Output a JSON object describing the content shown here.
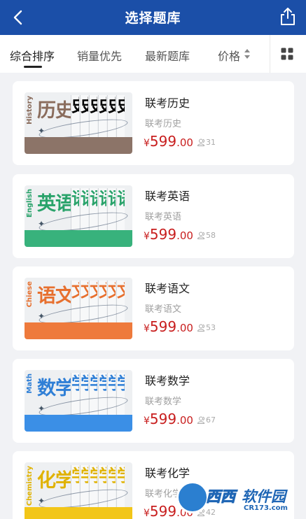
{
  "header": {
    "title": "选择题库"
  },
  "tabs": [
    {
      "label": "综合排序"
    },
    {
      "label": "销量优先"
    },
    {
      "label": "最新题库"
    },
    {
      "label": "价格"
    }
  ],
  "colors": {
    "header": "#1b4fa8",
    "price": "#c81e1e"
  },
  "items": [
    {
      "name": "联考历史",
      "subtitle": "联考历史",
      "currency": "¥",
      "price_int": "599",
      "price_dec": ".00",
      "buyers": "31",
      "cover": {
        "big": "历史",
        "vertical": "History",
        "book_char": "史",
        "band_color": "#8c7468",
        "text_color": "#8a6c5c"
      }
    },
    {
      "name": "联考英语",
      "subtitle": "联考英语",
      "currency": "¥",
      "price_int": "599",
      "price_dec": ".00",
      "buyers": "58",
      "cover": {
        "big": "英语",
        "vertical": "English",
        "book_char": "语",
        "band_color": "#38b27c",
        "text_color": "#2aa36b"
      }
    },
    {
      "name": "联考语文",
      "subtitle": "联考语文",
      "currency": "¥",
      "price_int": "599",
      "price_dec": ".00",
      "buyers": "53",
      "cover": {
        "big": "语文",
        "vertical": "Chiese",
        "book_char": "文",
        "band_color": "#ee7a3c",
        "text_color": "#e7702f"
      }
    },
    {
      "name": "联考数学",
      "subtitle": "联考数学",
      "currency": "¥",
      "price_int": "599",
      "price_dec": ".00",
      "buyers": "67",
      "cover": {
        "big": "数学",
        "vertical": "Math",
        "book_char": "学",
        "band_color": "#3b8fe6",
        "text_color": "#2f7fd6"
      }
    },
    {
      "name": "联考化学",
      "subtitle": "联考化学",
      "currency": "¥",
      "price_int": "599",
      "price_dec": ".00",
      "buyers": "42",
      "cover": {
        "big": "化学",
        "vertical": "Chemistry",
        "book_char": "学",
        "band_color": "#f2c619",
        "text_color": "#e0b200"
      }
    }
  ],
  "watermark": {
    "name_white": "西西",
    "name_blue": "软件园",
    "url": "CR173.com"
  }
}
